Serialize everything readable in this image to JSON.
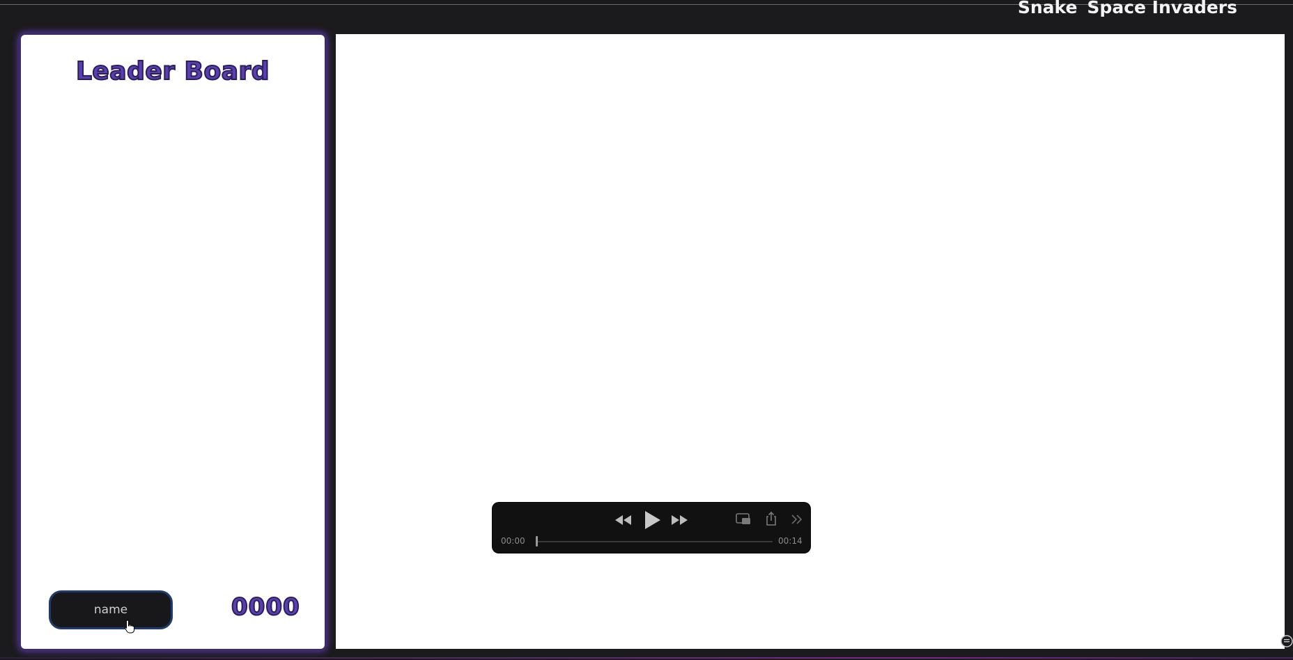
{
  "nav": {
    "links": [
      "Snake",
      "Space Invaders"
    ]
  },
  "leaderboard": {
    "title": "Leader Board",
    "name_input": {
      "value": "name",
      "placeholder": "name"
    },
    "score": "0000"
  },
  "media_player": {
    "current_time": "00:00",
    "duration": "00:14",
    "progress": 0,
    "state": "paused"
  },
  "colors": {
    "page_background": "#1b1a1c",
    "accent_purple": "#5a3fb0",
    "input_border": "#1f3a6e",
    "player_background": "#111112"
  }
}
